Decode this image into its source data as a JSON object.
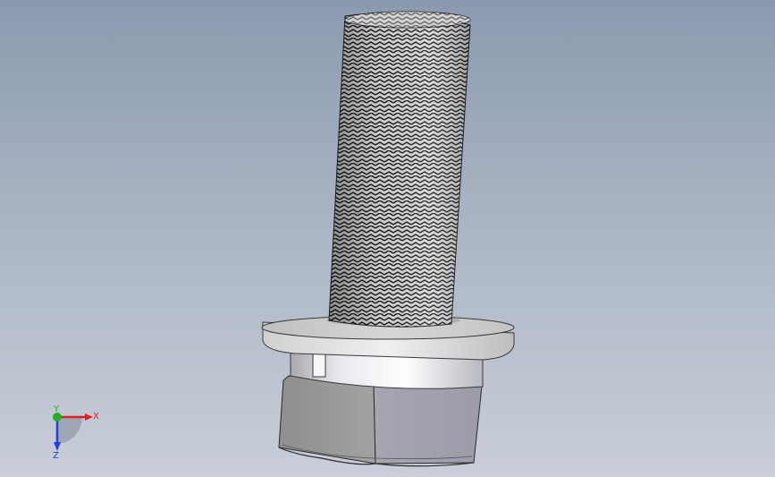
{
  "viewport": {
    "background_top": "#8b9aaf",
    "background_bottom": "#c9ced9"
  },
  "model": {
    "part": "bolt-with-flange-and-hex-nut"
  },
  "triad": {
    "x_label": "X",
    "y_label": "Y",
    "z_label": "Z",
    "x_color": "#e02020",
    "y_color": "#20b020",
    "z_color": "#2040e0"
  }
}
